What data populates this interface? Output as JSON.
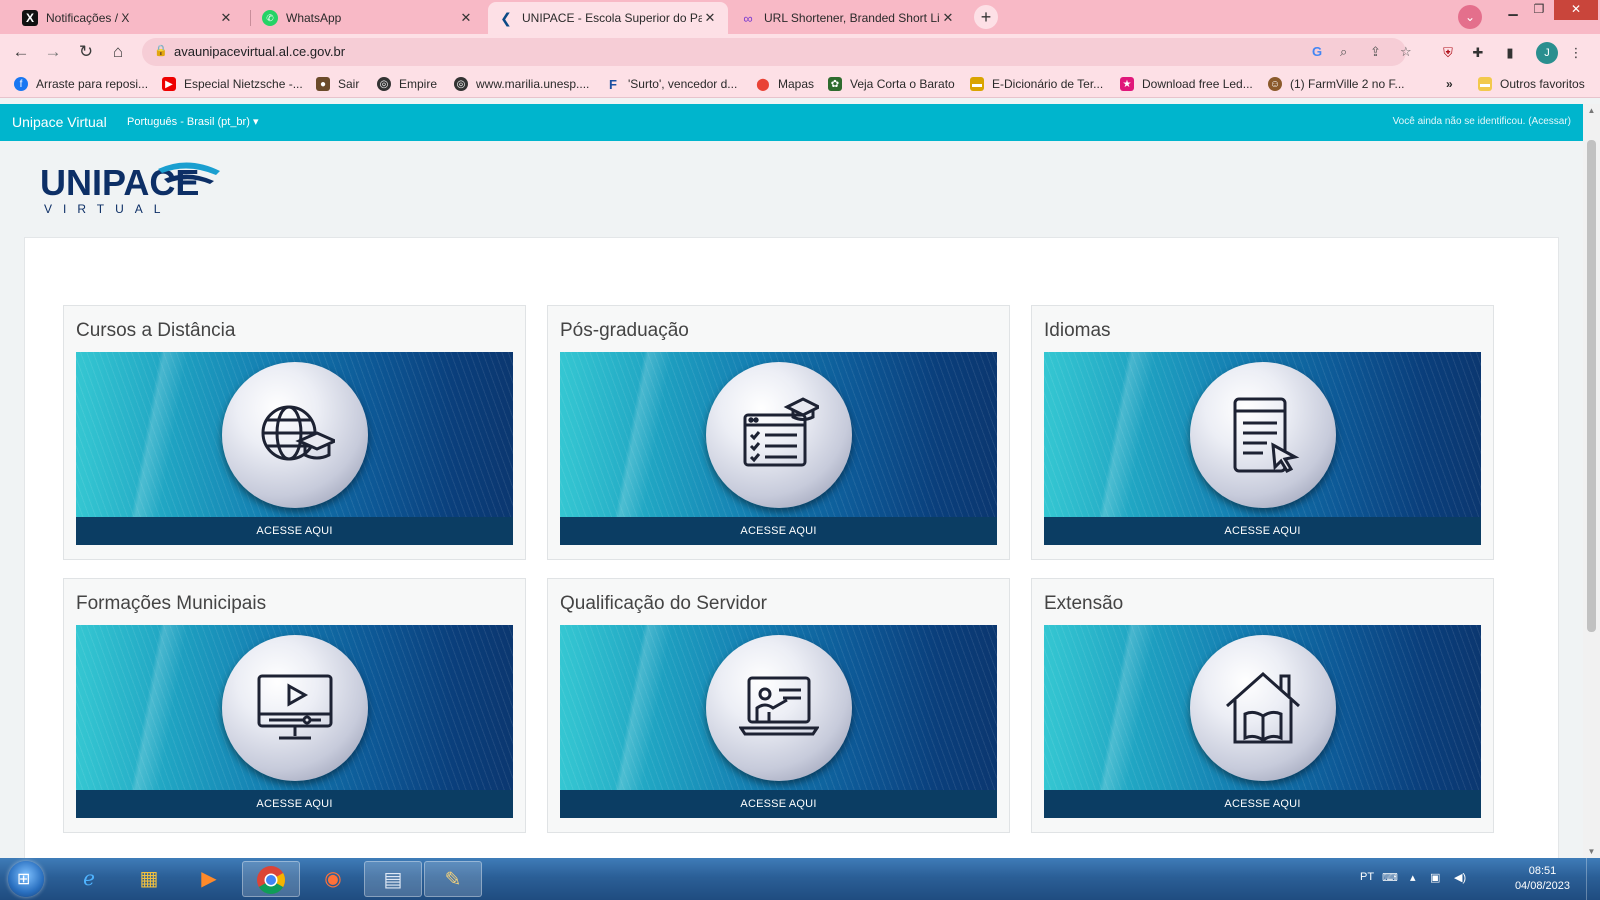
{
  "browser": {
    "tabs": [
      {
        "label": "Notificações / X",
        "icon": "x-logo-icon"
      },
      {
        "label": "WhatsApp",
        "icon": "whatsapp-icon"
      },
      {
        "label": "UNIPACE - Escola Superior do Pa",
        "icon": "unipace-favicon-icon",
        "active": true
      },
      {
        "label": "URL Shortener, Branded Short Li",
        "icon": "link-icon"
      }
    ],
    "url": "avaunipacevirtual.al.ce.gov.br",
    "profile_initial": "J",
    "bookmarks": [
      {
        "label": "Arraste para reposi...",
        "icon": "facebook-icon"
      },
      {
        "label": "Especial Nietzsche -...",
        "icon": "youtube-icon"
      },
      {
        "label": "Sair",
        "icon": "owl-icon"
      },
      {
        "label": "Empire",
        "icon": "globe-icon"
      },
      {
        "label": "www.marilia.unesp....",
        "icon": "globe-icon"
      },
      {
        "label": "'Surto', vencedor d...",
        "icon": "f-logo-icon"
      },
      {
        "label": "Mapas",
        "icon": "maps-pin-icon"
      },
      {
        "label": "Veja Corta o Barato",
        "icon": "leaf-icon"
      },
      {
        "label": "E-Dicionário de Ter...",
        "icon": "folder-icon"
      },
      {
        "label": "Download free Led...",
        "icon": "star-badge-icon"
      },
      {
        "label": "(1) FarmVille 2 no F...",
        "icon": "farmville-icon"
      }
    ],
    "bookmarks_more": "»",
    "other_bookmarks": "Outros favoritos"
  },
  "site": {
    "brand": "Unipace Virtual",
    "language": "Português - Brasil (pt_br)",
    "login_text": "Você ainda não se identificou. (Acessar)",
    "logo_text": "UNIPACE",
    "logo_sub": "VIRTUAL",
    "colors": {
      "navbar": "#00b5cd",
      "button": "#0b3d63"
    }
  },
  "cards": [
    {
      "title": "Cursos a Distância",
      "button": "ACESSE AQUI",
      "icon": "globe-graduation-cap-icon"
    },
    {
      "title": "Pós-graduação",
      "button": "ACESSE AQUI",
      "icon": "checklist-graduation-cap-icon"
    },
    {
      "title": "Idiomas",
      "button": "ACESSE AQUI",
      "icon": "document-cursor-icon"
    },
    {
      "title": "Formações Municipais",
      "button": "ACESSE AQUI",
      "icon": "monitor-video-icon"
    },
    {
      "title": "Qualificação do Servidor",
      "button": "ACESSE AQUI",
      "icon": "teacher-screen-icon"
    },
    {
      "title": "Extensão",
      "button": "ACESSE AQUI",
      "icon": "house-book-icon"
    }
  ],
  "taskbar": {
    "language": "PT",
    "time": "08:51",
    "date": "04/08/2023"
  }
}
